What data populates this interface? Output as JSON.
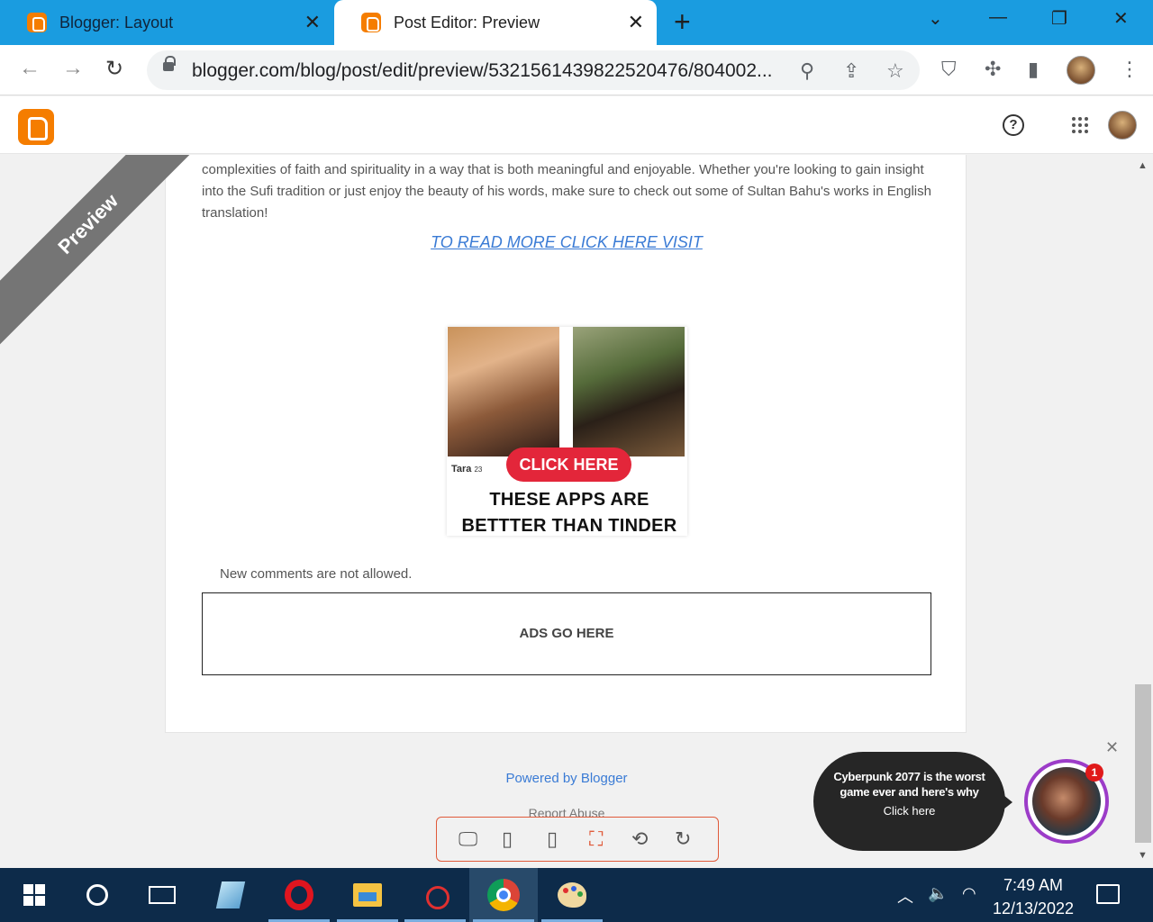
{
  "browser": {
    "tabs": [
      {
        "title": "Blogger: Layout",
        "active": false
      },
      {
        "title": "Post Editor: Preview",
        "active": true
      }
    ],
    "new_tab_glyph": "+",
    "url": "blogger.com/blog/post/edit/preview/5321561439822520476/804002...",
    "icons": [
      "back-icon",
      "forward-icon",
      "reload-icon",
      "lock-icon",
      "zoom-icon",
      "share-icon",
      "bookmark-star-icon",
      "shield-extension-icon",
      "extensions-puzzle-icon",
      "side-panel-icon",
      "profile-avatar",
      "menu-dots-icon"
    ]
  },
  "blogger_header": {
    "help_glyph": "?"
  },
  "preview_ribbon": "Preview",
  "post": {
    "text": "complexities of faith and spirituality in a way that is both meaningful and enjoyable. Whether you're looking to gain insight into the Sufi tradition or just enjoy the beauty of his words, make sure to check out some of Sultan Bahu's works in English translation!",
    "read_more_link": "TO READ MORE CLICK HERE VISIT",
    "ad_image": {
      "profile_name": "Tara",
      "profile_age": "23",
      "button_label": "CLICK HERE",
      "caption_line1": "THESE APPS ARE",
      "caption_line2": "BETTTER THAN TINDER"
    },
    "comments_note": "New comments are not allowed.",
    "ads_placeholder": "ADS GO HERE"
  },
  "footer": {
    "powered_by": "Powered by Blogger",
    "report_abuse": "Report Abuse"
  },
  "device_toolbar": {
    "icons": [
      "desktop-icon",
      "tablet-icon",
      "phone-icon",
      "fullscreen-icon",
      "rotate-icon",
      "refresh-icon"
    ]
  },
  "notification": {
    "title": "Cyberpunk 2077 is the worst game ever and here's why",
    "cta": "Click here",
    "badge_count": "1",
    "close_glyph": "✕"
  },
  "taskbar": {
    "time": "7:49 AM",
    "date": "12/13/2022"
  },
  "colors": {
    "chrome_tab_strip": "#1a9ce0",
    "blogger_orange": "#f57d00",
    "link_blue": "#3a7bd5",
    "ad_button_red": "#e3263a",
    "taskbar": "#0d2b4a",
    "notification_ring": "#9c3cc8"
  }
}
